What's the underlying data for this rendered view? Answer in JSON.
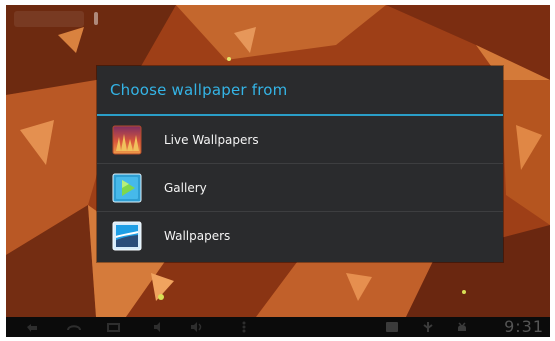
{
  "dialog": {
    "title": "Choose wallpaper from",
    "items": [
      {
        "label": "Live Wallpapers",
        "icon": "live-wallpapers-icon"
      },
      {
        "label": "Gallery",
        "icon": "gallery-icon"
      },
      {
        "label": "Wallpapers",
        "icon": "wallpapers-icon"
      }
    ]
  },
  "status_bar": {
    "time": "9:31"
  },
  "colors": {
    "accent": "#34b4e6",
    "dialog_bg": "#2a2b2d",
    "nav_bar": "#0b0b0b"
  }
}
